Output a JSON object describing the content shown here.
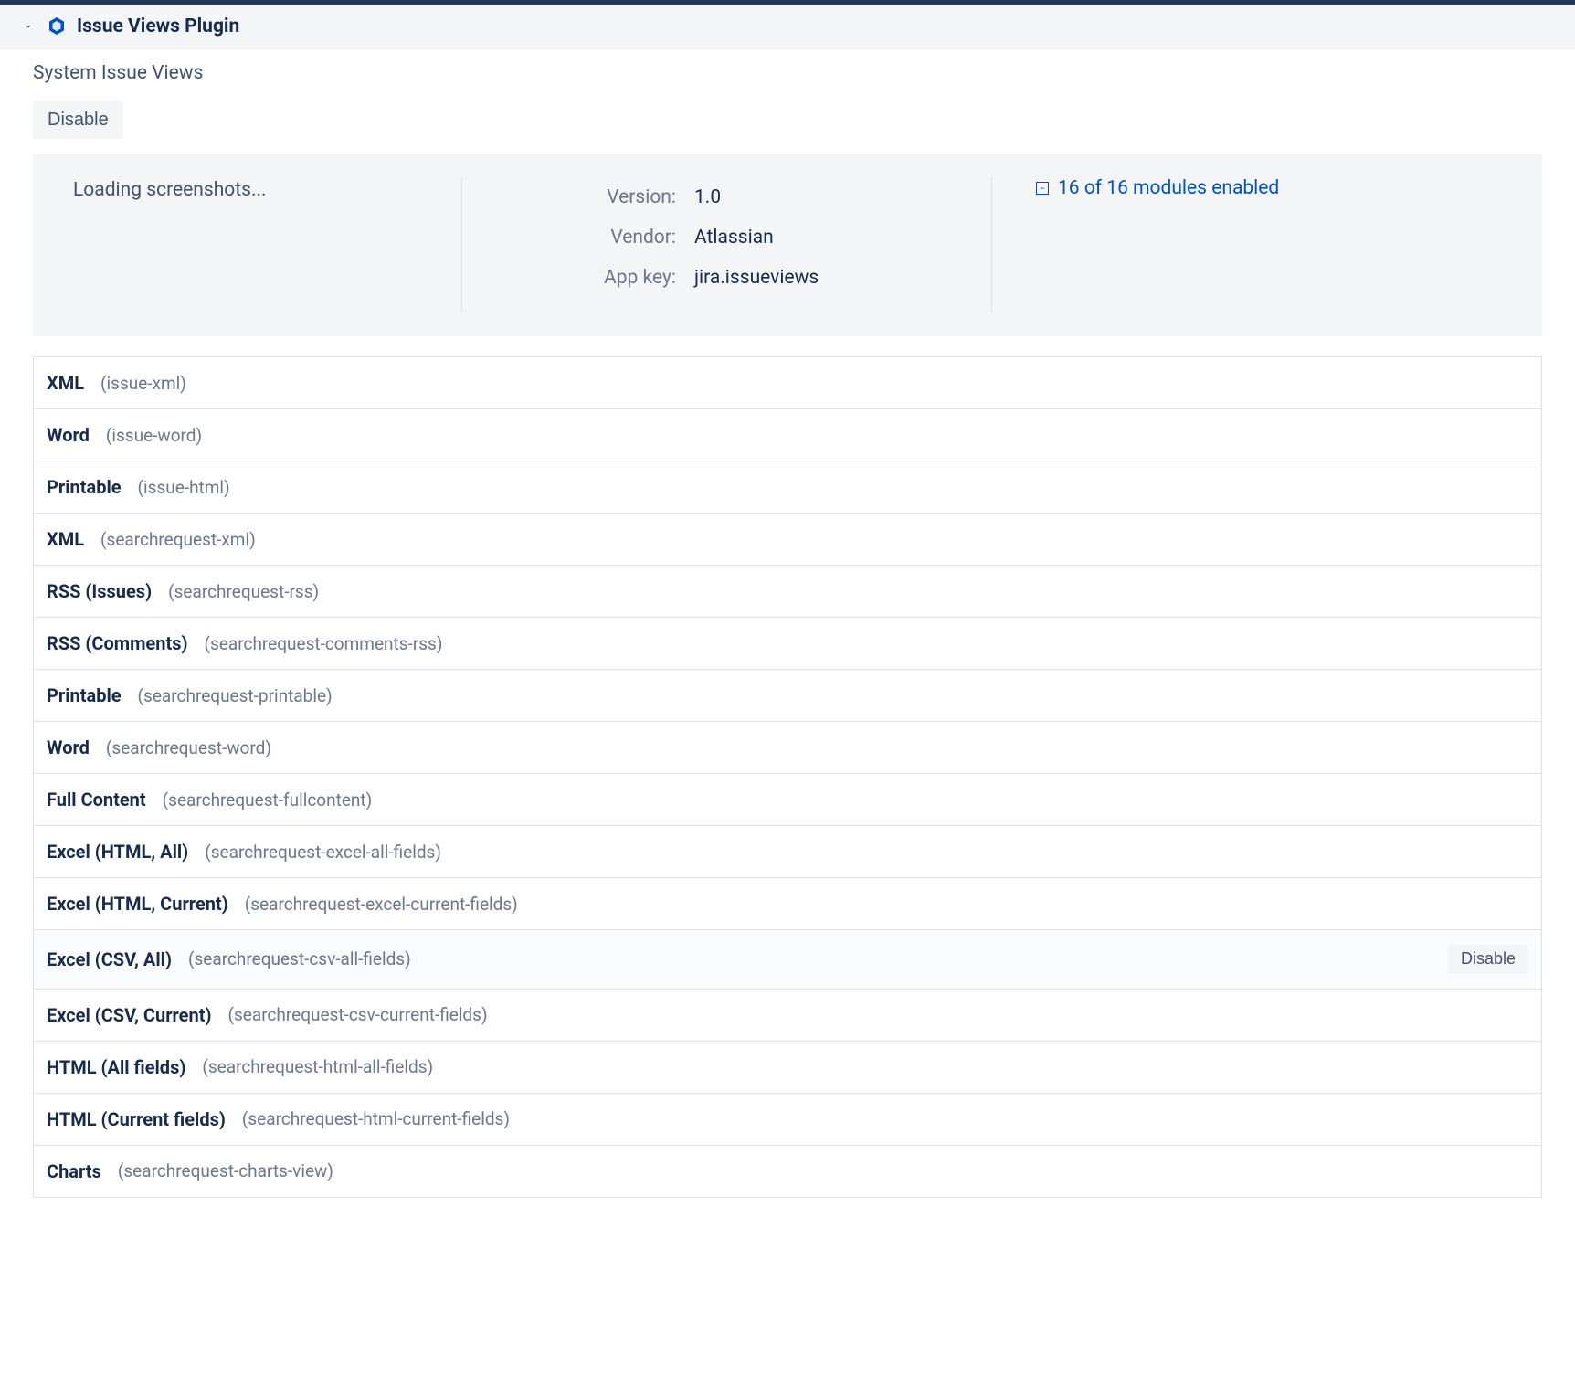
{
  "header": {
    "title": "Issue Views Plugin"
  },
  "subtitle": "System Issue Views",
  "disable_label": "Disable",
  "info": {
    "loading_text": "Loading screenshots...",
    "version_label": "Version:",
    "version_value": "1.0",
    "vendor_label": "Vendor:",
    "vendor_value": "Atlassian",
    "appkey_label": "App key:",
    "appkey_value": "jira.issueviews",
    "modules_text": "16 of 16 modules enabled"
  },
  "modules": [
    {
      "name": "XML",
      "id": "(issue-xml)"
    },
    {
      "name": "Word",
      "id": "(issue-word)"
    },
    {
      "name": "Printable",
      "id": "(issue-html)"
    },
    {
      "name": "XML",
      "id": "(searchrequest-xml)"
    },
    {
      "name": "RSS (Issues)",
      "id": "(searchrequest-rss)"
    },
    {
      "name": "RSS (Comments)",
      "id": "(searchrequest-comments-rss)"
    },
    {
      "name": "Printable",
      "id": "(searchrequest-printable)"
    },
    {
      "name": "Word",
      "id": "(searchrequest-word)"
    },
    {
      "name": "Full Content",
      "id": "(searchrequest-fullcontent)"
    },
    {
      "name": "Excel (HTML, All)",
      "id": "(searchrequest-excel-all-fields)"
    },
    {
      "name": "Excel (HTML, Current)",
      "id": "(searchrequest-excel-current-fields)"
    },
    {
      "name": "Excel (CSV, All)",
      "id": "(searchrequest-csv-all-fields)",
      "hover": true,
      "action_label": "Disable"
    },
    {
      "name": "Excel (CSV, Current)",
      "id": "(searchrequest-csv-current-fields)"
    },
    {
      "name": "HTML (All fields)",
      "id": "(searchrequest-html-all-fields)"
    },
    {
      "name": "HTML (Current fields)",
      "id": "(searchrequest-html-current-fields)"
    },
    {
      "name": "Charts",
      "id": "(searchrequest-charts-view)"
    }
  ]
}
